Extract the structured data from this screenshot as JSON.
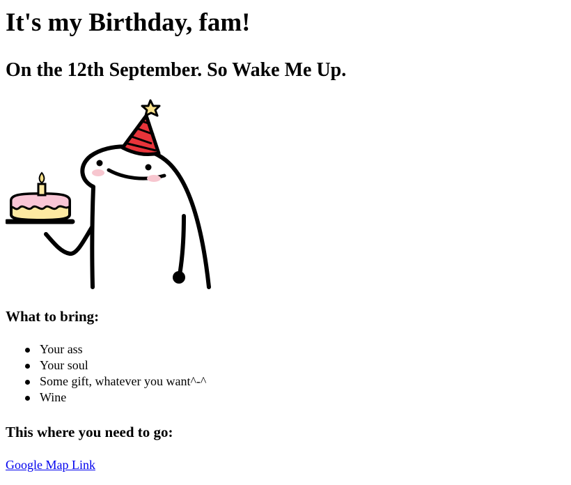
{
  "heading": {
    "title": "It's my Birthday, fam!",
    "subtitle": "On the 12th September. So Wake Me Up."
  },
  "illustration": {
    "icon": "birthday-blob-character-with-cake-illustration"
  },
  "bring": {
    "heading": "What to bring:",
    "items": [
      "Your ass",
      "Your soul",
      "Some gift, whatever you want^-^",
      "Wine"
    ]
  },
  "location": {
    "heading": "This where you need to go:",
    "link_text": "Google Map Link"
  },
  "colors": {
    "link": "#0000ee",
    "hat_red": "#e8343a",
    "star_yellow": "#fbe28b",
    "frosting_pink": "#f9c6d6",
    "cake_yellow": "#fde9a2",
    "blush": "#f7c6cf"
  }
}
